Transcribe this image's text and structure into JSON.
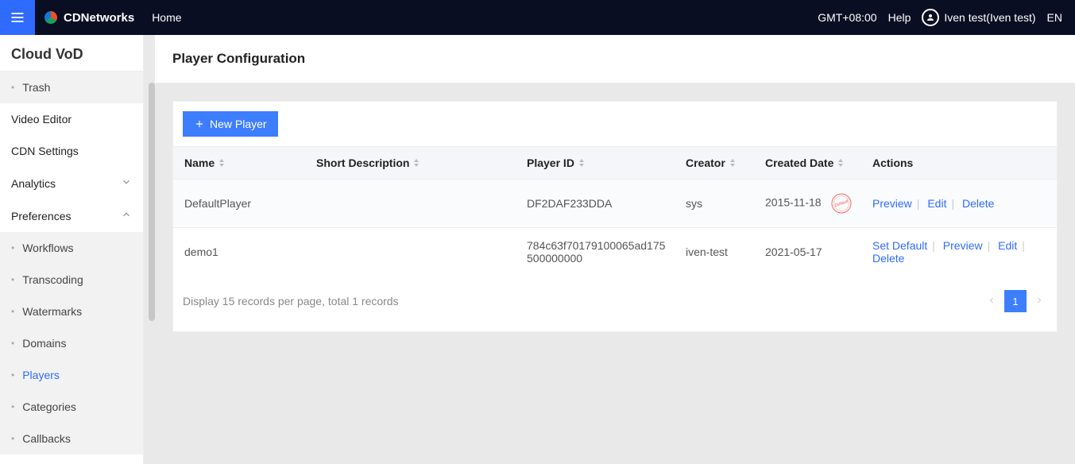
{
  "topbar": {
    "brand": "CDNetworks",
    "home": "Home",
    "tz": "GMT+08:00",
    "help": "Help",
    "user": "Iven test(Iven test)",
    "lang": "EN"
  },
  "sidebar": {
    "product": "Cloud VoD",
    "items": [
      {
        "label": "Trash",
        "sub": true
      },
      {
        "label": "Video Editor",
        "sub": false
      },
      {
        "label": "CDN Settings",
        "sub": false
      },
      {
        "label": "Analytics",
        "sub": false,
        "expandable": true,
        "open": false
      },
      {
        "label": "Preferences",
        "sub": false,
        "expandable": true,
        "open": true
      },
      {
        "label": "Workflows",
        "sub": true
      },
      {
        "label": "Transcoding",
        "sub": true
      },
      {
        "label": "Watermarks",
        "sub": true
      },
      {
        "label": "Domains",
        "sub": true
      },
      {
        "label": "Players",
        "sub": true,
        "active": true
      },
      {
        "label": "Categories",
        "sub": true
      },
      {
        "label": "Callbacks",
        "sub": true
      }
    ]
  },
  "page": {
    "title": "Player Configuration",
    "newButton": "New Player",
    "columns": {
      "name": "Name",
      "short": "Short Description",
      "pid": "Player ID",
      "creator": "Creator",
      "created": "Created Date",
      "actions": "Actions"
    },
    "rows": [
      {
        "name": "DefaultPlayer",
        "short": "",
        "pid": "DF2DAF233DDA",
        "creator": "sys",
        "created": "2015-11-18",
        "default": true,
        "actions": [
          "Preview",
          "Edit",
          "Delete"
        ]
      },
      {
        "name": "demo1",
        "short": "",
        "pid": "784c63f70179100065ad175500000000",
        "creator": "iven-test",
        "created": "2021-05-17",
        "default": false,
        "actions": [
          "Set Default",
          "Preview",
          "Edit",
          "Delete"
        ]
      }
    ],
    "footer": "Display 15 records per page, total 1 records",
    "defaultBadge": "Default",
    "pager": {
      "page": "1"
    }
  }
}
